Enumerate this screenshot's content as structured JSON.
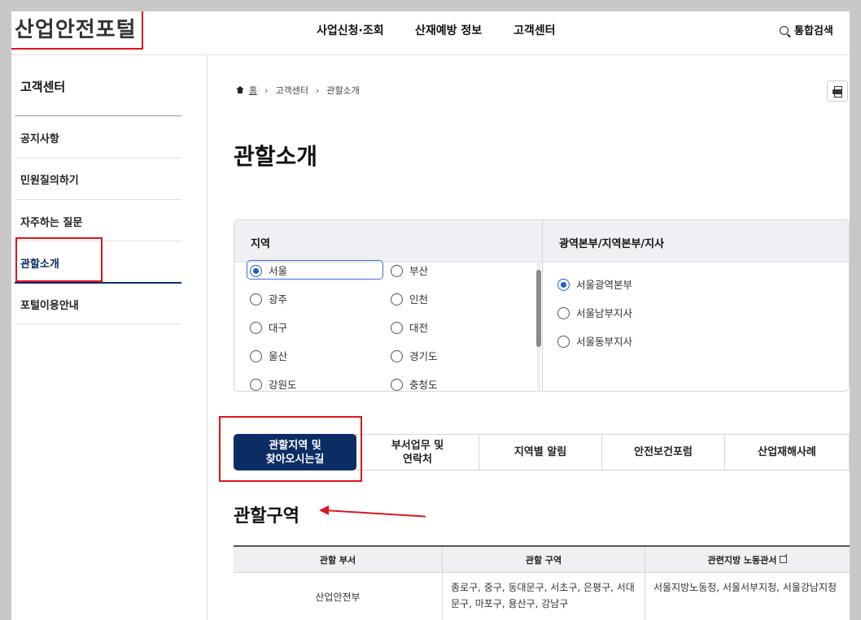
{
  "header": {
    "logo": "산업안전포털",
    "nav": [
      "사업신청·조회",
      "산재예방 정보",
      "고객센터"
    ],
    "search_label": "통합검색"
  },
  "sidebar": {
    "title": "고객센터",
    "items": [
      {
        "label": "공지사항",
        "active": false
      },
      {
        "label": "민원질의하기",
        "active": false
      },
      {
        "label": "자주하는 질문",
        "active": false
      },
      {
        "label": "관할소개",
        "active": true
      },
      {
        "label": "포털이용안내",
        "active": false
      }
    ]
  },
  "breadcrumb": {
    "home": "홈",
    "items": [
      "고객센터",
      "관할소개"
    ]
  },
  "page_title": "관할소개",
  "region_selector": {
    "left_header": "지역",
    "right_header": "광역본부/지역본부/지사",
    "regions": [
      {
        "label": "서울",
        "selected": true
      },
      {
        "label": "부산",
        "selected": false
      },
      {
        "label": "광주",
        "selected": false
      },
      {
        "label": "인천",
        "selected": false
      },
      {
        "label": "대구",
        "selected": false
      },
      {
        "label": "대전",
        "selected": false
      },
      {
        "label": "울산",
        "selected": false
      },
      {
        "label": "경기도",
        "selected": false
      },
      {
        "label": "강원도",
        "selected": false
      },
      {
        "label": "충청도",
        "selected": false
      }
    ],
    "offices": [
      {
        "label": "서울광역본부",
        "selected": true
      },
      {
        "label": "서울남부지사",
        "selected": false
      },
      {
        "label": "서울동부지사",
        "selected": false
      }
    ]
  },
  "tabs": [
    {
      "label": "관할지역 및\n찾아오시는길",
      "active": true
    },
    {
      "label": "부서업무 및\n연락처",
      "active": false
    },
    {
      "label": "지역별 알림",
      "active": false
    },
    {
      "label": "안전보건포럼",
      "active": false
    },
    {
      "label": "산업재해사례",
      "active": false
    }
  ],
  "section_title": "관할구역",
  "table": {
    "headers": [
      "관할 부서",
      "관할 구역",
      "관련지방 노동관서"
    ],
    "rows": [
      [
        "산업안전부",
        "종로구, 중구, 동대문구, 서초구, 은평구, 서대문구, 마포구, 용산구, 강남구",
        "서울지방노동청, 서울서부지청, 서울강남지청"
      ]
    ]
  },
  "colors": {
    "accent": "#0c2d64",
    "radio": "#1f5fd6",
    "annotation": "#e0141c"
  }
}
